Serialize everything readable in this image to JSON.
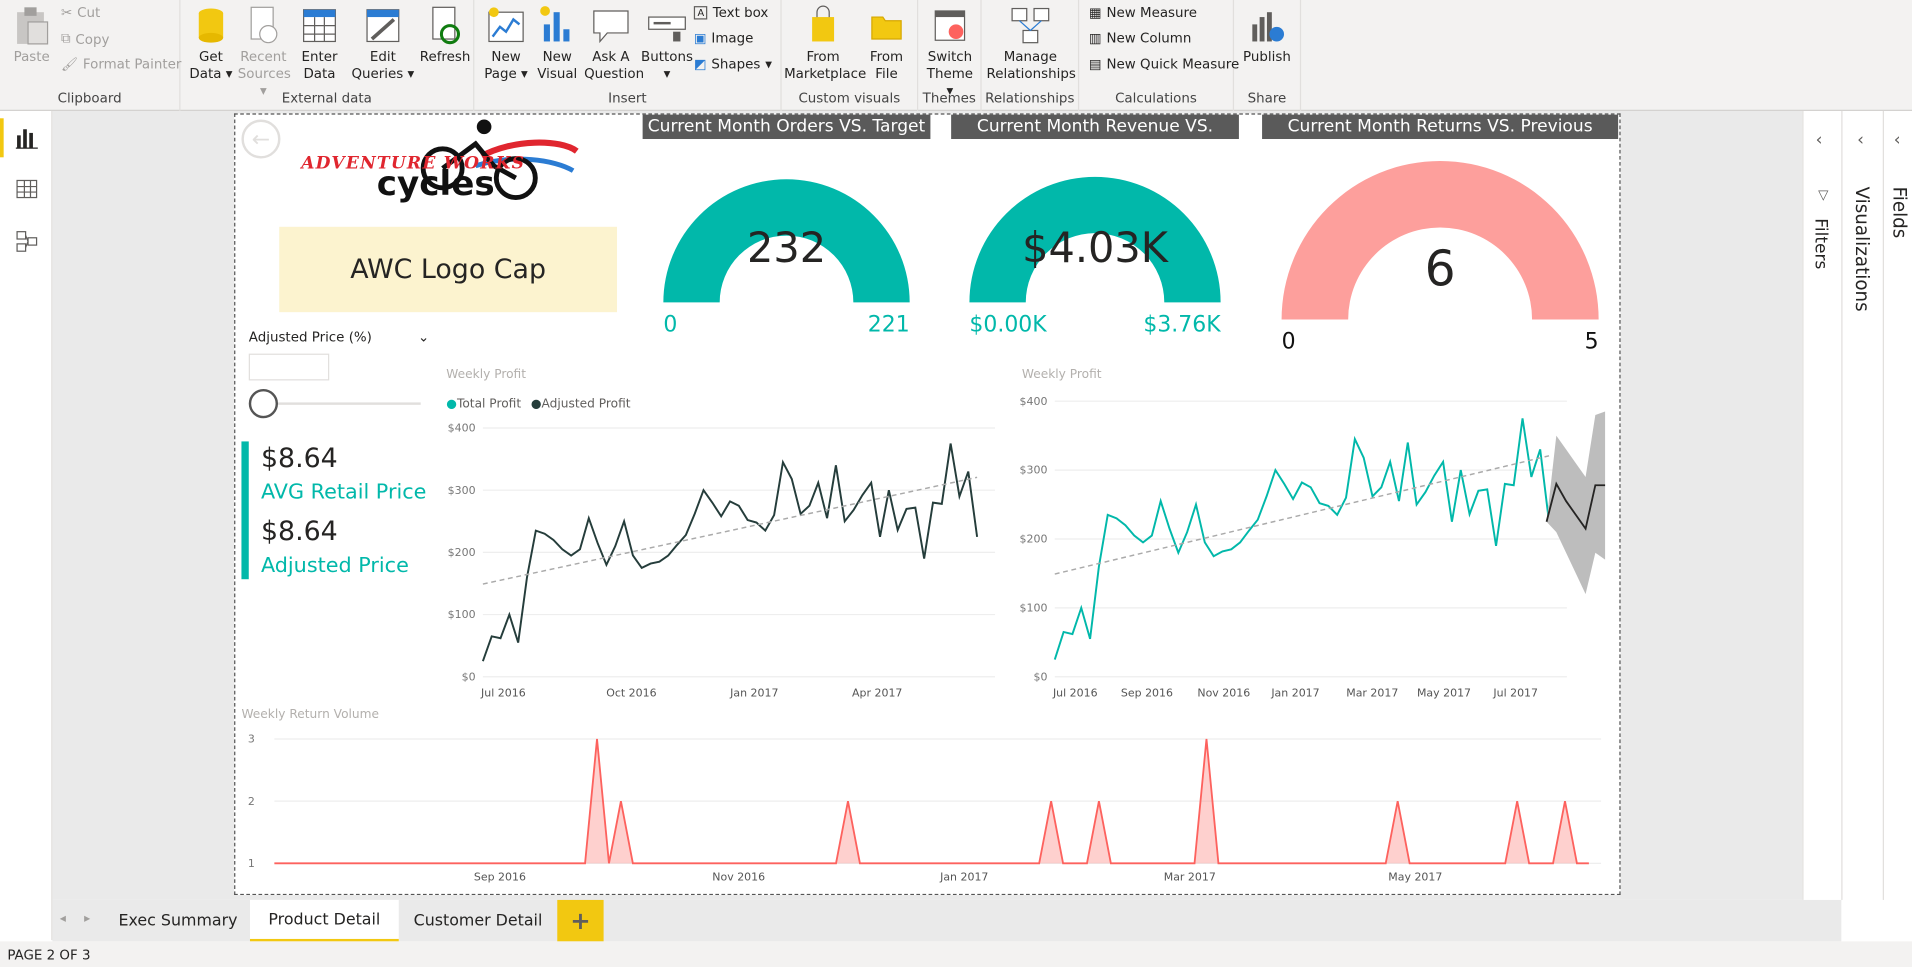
{
  "ribbon": {
    "clipboard": {
      "group": "Clipboard",
      "paste": "Paste",
      "cut": "Cut",
      "copy": "Copy",
      "format_painter": "Format Painter"
    },
    "external": {
      "group": "External data",
      "get_data": "Get",
      "get_data2": "Data",
      "recent": "Recent",
      "recent2": "Sources",
      "enter": "Enter",
      "enter2": "Data",
      "edit": "Edit",
      "edit2": "Queries",
      "refresh": "Refresh"
    },
    "insert": {
      "group": "Insert",
      "new_page": "New",
      "new_page2": "Page",
      "new_visual": "New",
      "new_visual2": "Visual",
      "ask": "Ask A",
      "ask2": "Question",
      "buttons": "Buttons",
      "text_box": "Text box",
      "image": "Image",
      "shapes": "Shapes"
    },
    "custom": {
      "group": "Custom visuals",
      "marketplace": "From",
      "marketplace2": "Marketplace",
      "file": "From",
      "file2": "File"
    },
    "themes": {
      "group": "Themes",
      "switch": "Switch",
      "switch2": "Theme"
    },
    "relationships": {
      "group": "Relationships",
      "manage": "Manage",
      "manage2": "Relationships"
    },
    "calculations": {
      "group": "Calculations",
      "new_measure": "New Measure",
      "new_column": "New Column",
      "new_quick": "New Quick Measure"
    },
    "share": {
      "group": "Share",
      "publish": "Publish"
    }
  },
  "right_panels": {
    "filters": "Filters",
    "visualizations": "Visualizations",
    "fields": "Fields"
  },
  "report": {
    "logo_line1": "ADVENTURE WORKS",
    "logo_line2": "cycles",
    "product_card": "AWC Logo Cap",
    "slicer": {
      "label": "Adjusted Price (%)",
      "value_box": ""
    },
    "kpis": [
      {
        "value": "$8.64",
        "label": "AVG Retail Price"
      },
      {
        "value": "$8.64",
        "label": "Adjusted Price"
      }
    ],
    "gauges": [
      {
        "title": "Current Month Orders VS. Target",
        "value": "232",
        "min": "0",
        "max": "221",
        "fill": 1.0,
        "color": "#01b8aa"
      },
      {
        "title": "Current Month Revenue VS. Target",
        "value": "$4.03K",
        "min": "$0.00K",
        "max": "$3.76K",
        "fill": 1.0,
        "color": "#01b8aa"
      },
      {
        "title": "Current Month Returns VS. Previous Month",
        "value": "6",
        "min": "0",
        "max": "5",
        "fill": 1.0,
        "color": "#fd9f9c"
      }
    ]
  },
  "tabs": [
    "Exec Summary",
    "Product Detail",
    "Customer Detail"
  ],
  "add_tab": "+",
  "status": "PAGE 2 OF 3",
  "chart_data": [
    {
      "type": "line",
      "title": "Weekly Profit",
      "legend": [
        "Total Profit",
        "Adjusted Profit"
      ],
      "legend_colors": [
        "#01b8aa",
        "#253d3b"
      ],
      "legend_position": "top-left",
      "ylim": [
        0,
        400
      ],
      "yticks": [
        "$0",
        "$100",
        "$200",
        "$300",
        "$400"
      ],
      "xticks": [
        "Jul 2016",
        "Oct 2016",
        "Jan 2017",
        "Apr 2017"
      ],
      "trend_line": true,
      "series": [
        {
          "name": "Adjusted Profit",
          "color": "#253d3b",
          "values": [
            25,
            65,
            62,
            100,
            55,
            160,
            235,
            230,
            220,
            205,
            195,
            205,
            255,
            215,
            180,
            210,
            250,
            195,
            175,
            182,
            185,
            195,
            212,
            228,
            262,
            300,
            280,
            258,
            282,
            275,
            252,
            248,
            235,
            260,
            345,
            318,
            262,
            275,
            312,
            255,
            340,
            250,
            268,
            292,
            312,
            225,
            300,
            236,
            270,
            272,
            190,
            280,
            278,
            375,
            290,
            330,
            225
          ]
        }
      ]
    },
    {
      "type": "line",
      "title": "Weekly Profit",
      "ylim": [
        0,
        400
      ],
      "yticks": [
        "$0",
        "$100",
        "$200",
        "$300",
        "$400"
      ],
      "xticks": [
        "Jul 2016",
        "Sep 2016",
        "Nov 2016",
        "Jan 2017",
        "Mar 2017",
        "May 2017",
        "Jul 2017"
      ],
      "trend_line": true,
      "forecast": true,
      "series": [
        {
          "name": "Total Profit",
          "color": "#01b8aa",
          "values": [
            25,
            65,
            62,
            100,
            55,
            160,
            235,
            230,
            220,
            205,
            195,
            205,
            255,
            215,
            180,
            210,
            250,
            195,
            175,
            182,
            185,
            195,
            212,
            228,
            262,
            300,
            280,
            258,
            282,
            275,
            252,
            248,
            235,
            260,
            345,
            318,
            262,
            275,
            312,
            255,
            340,
            250,
            268,
            292,
            312,
            225,
            300,
            236,
            270,
            272,
            190,
            280,
            278,
            375,
            290,
            330,
            225
          ]
        },
        {
          "name": "Forecast",
          "color": "#252423",
          "values": [
            225,
            280,
            255,
            235,
            215,
            278,
            278
          ],
          "upper": [
            225,
            350,
            330,
            310,
            290,
            380,
            385
          ],
          "lower": [
            225,
            210,
            180,
            150,
            120,
            180,
            170
          ]
        }
      ]
    },
    {
      "type": "area",
      "title": "Weekly Return Volume",
      "ylim": [
        1,
        3
      ],
      "yticks": [
        "1",
        "2",
        "3"
      ],
      "xticks": [
        "Sep 2016",
        "Nov 2016",
        "Jan 2017",
        "Mar 2017",
        "May 2017"
      ],
      "color": "#fd625e",
      "values": [
        1,
        1,
        1,
        1,
        1,
        1,
        1,
        1,
        1,
        1,
        1,
        1,
        1,
        1,
        1,
        1,
        1,
        1,
        1,
        1,
        1,
        1,
        1,
        1,
        1,
        1,
        1,
        3,
        1,
        2,
        1,
        1,
        1,
        1,
        1,
        1,
        1,
        1,
        1,
        1,
        1,
        1,
        1,
        1,
        1,
        1,
        1,
        1,
        2,
        1,
        1,
        1,
        1,
        1,
        1,
        1,
        1,
        1,
        1,
        1,
        1,
        1,
        1,
        1,
        1,
        2,
        1,
        1,
        1,
        2,
        1,
        1,
        1,
        1,
        1,
        1,
        1,
        1,
        3,
        1,
        1,
        1,
        1,
        1,
        1,
        1,
        1,
        1,
        1,
        1,
        1,
        1,
        1,
        1,
        2,
        1,
        1,
        1,
        1,
        1,
        1,
        1,
        1,
        1,
        2,
        1,
        1,
        1,
        2,
        1,
        1
      ]
    }
  ]
}
